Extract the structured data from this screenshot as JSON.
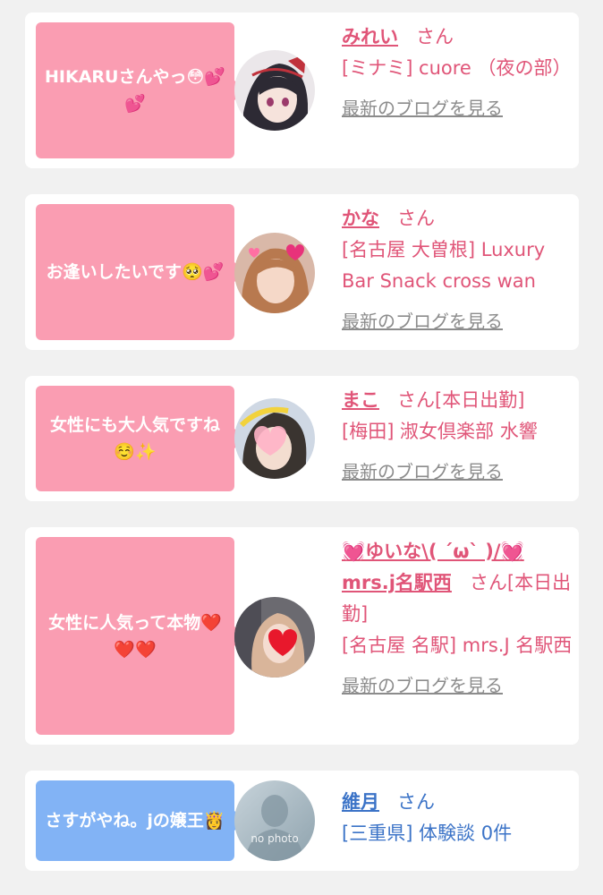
{
  "items": [
    {
      "message": "HIKARUさんやっ😳💕💕",
      "name": "みれい",
      "honorific": "さん",
      "status": "",
      "shop": "[ミナミ] cuore （夜の部）",
      "blog_link": "最新のブログを見る"
    },
    {
      "message": "お逢いしたいです🥺💕",
      "name": "かな",
      "honorific": "さん",
      "status": "",
      "shop": "[名古屋 大曽根] Luxury Bar Snack cross wan",
      "blog_link": "最新のブログを見る"
    },
    {
      "message": "女性にも大人気ですね☺️✨",
      "name": "まこ",
      "honorific": "さん",
      "status": "[本日出勤]",
      "shop": "[梅田] 淑女倶楽部 水響",
      "blog_link": "最新のブログを見る"
    },
    {
      "message": "女性に人気って本物❤️❤️❤️",
      "name": "💓ゆいな\\( ´ω` )/💓mrs.j名駅西",
      "honorific": "さん",
      "status": "[本日出勤]",
      "shop": "[名古屋 名駅] mrs.J 名駅西",
      "blog_link": "最新のブログを見る"
    },
    {
      "message": "さすがやね。jの嬢王👸",
      "name": "維月",
      "honorific": "さん",
      "status": "",
      "shop": "[三重県] 体験談 0件",
      "blog_link": "",
      "avatar_text": "no photo"
    }
  ],
  "colors": {
    "pink_bubble": "#fa9db2",
    "blue_bubble": "#82b3f5",
    "pink_text": "#e05578",
    "blue_text": "#3b73c7",
    "link_gray": "#8c8c8c"
  }
}
